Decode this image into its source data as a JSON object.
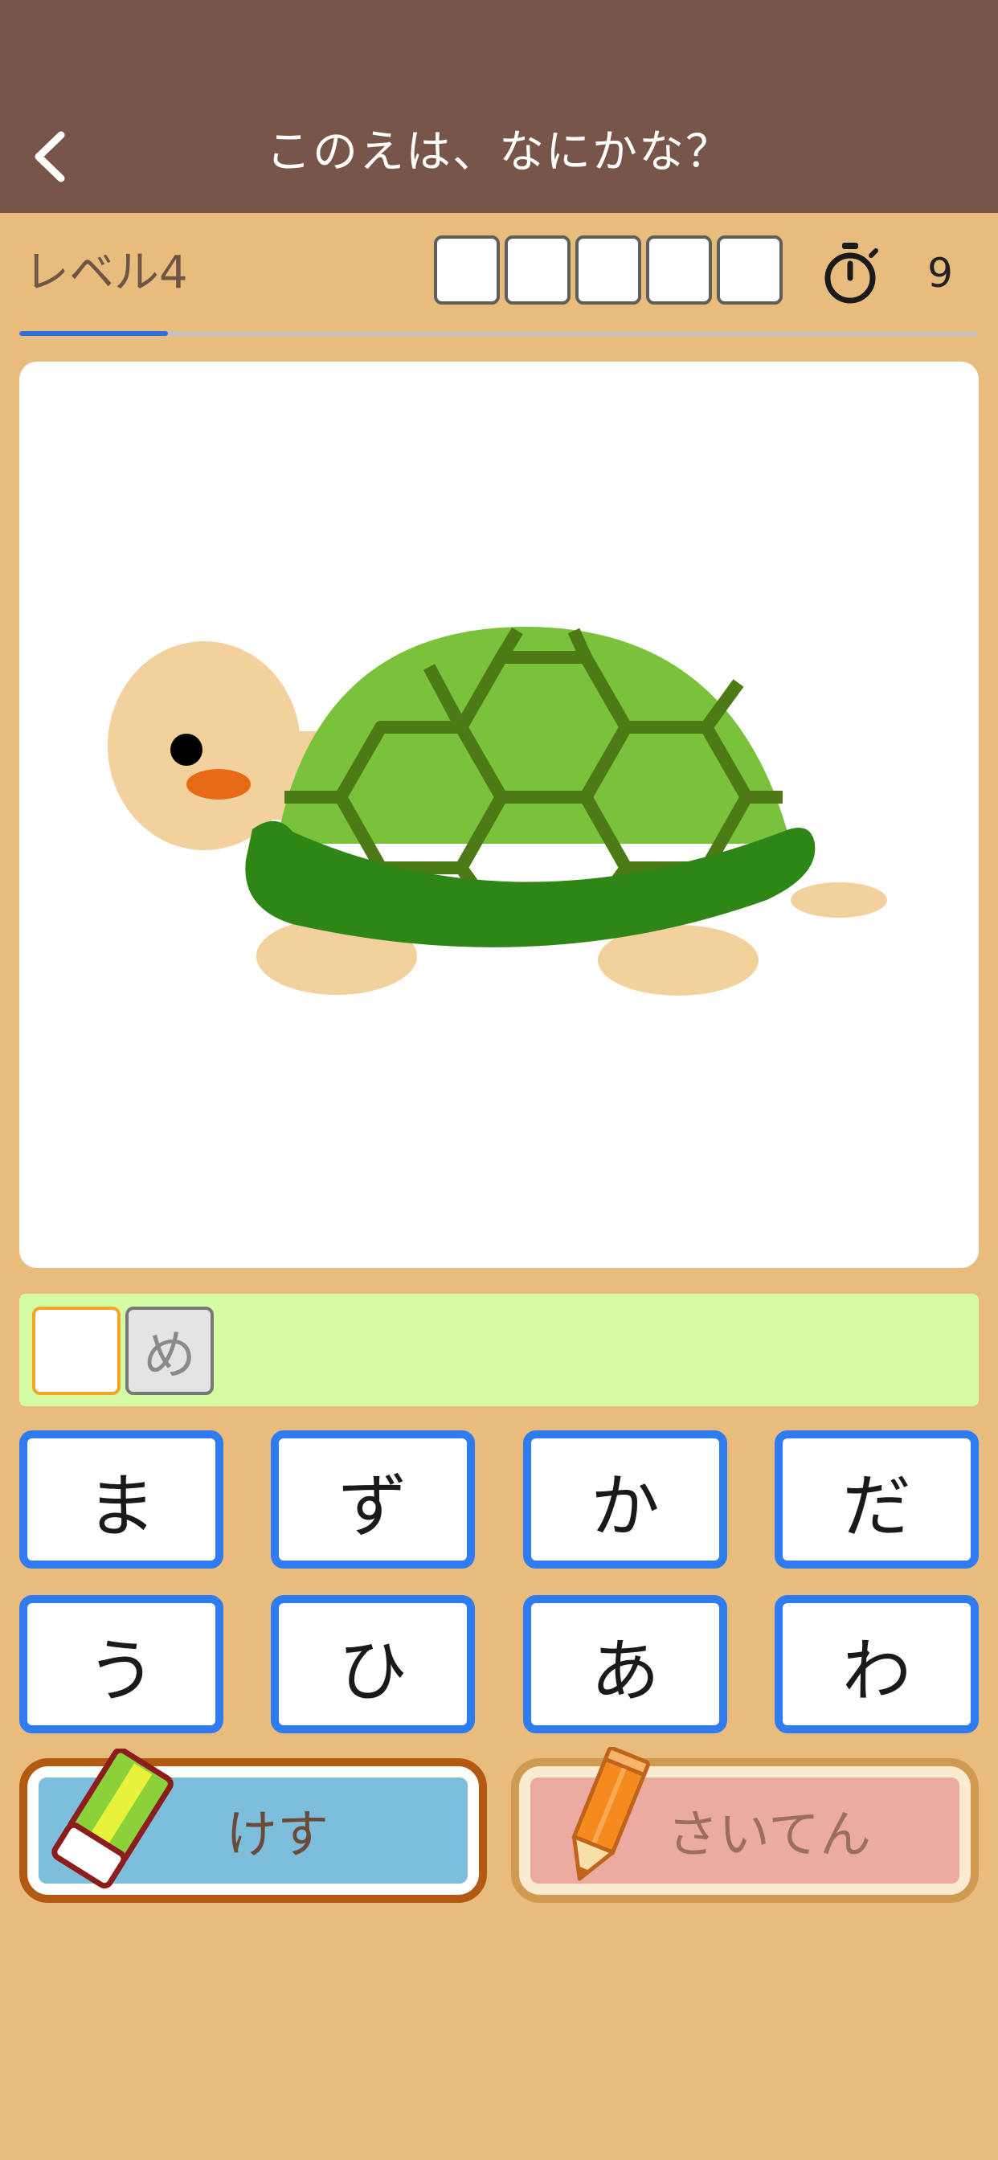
{
  "header": {
    "title": "このえは、なにかな？",
    "back_icon": "chevron-left-icon"
  },
  "status": {
    "level_label": "レベル4",
    "timer_icon": "stopwatch-icon",
    "timer_value": "9",
    "progress_fraction": 0.155
  },
  "picture": {
    "icon": "turtle-illustration"
  },
  "answer": {
    "filled_char": "め"
  },
  "keys": [
    {
      "char": "ま"
    },
    {
      "char": "ず"
    },
    {
      "char": "か"
    },
    {
      "char": "だ"
    },
    {
      "char": "う"
    },
    {
      "char": "ひ"
    },
    {
      "char": "あ"
    },
    {
      "char": "わ"
    }
  ],
  "actions": {
    "erase_label": "けす",
    "grade_label": "さいてん"
  },
  "colors": {
    "header": "#775548",
    "background": "#E8BC7C",
    "key_border": "#2F7BF0",
    "answer_bar": "#D4FCA3",
    "progress": "#2F6FE0"
  }
}
